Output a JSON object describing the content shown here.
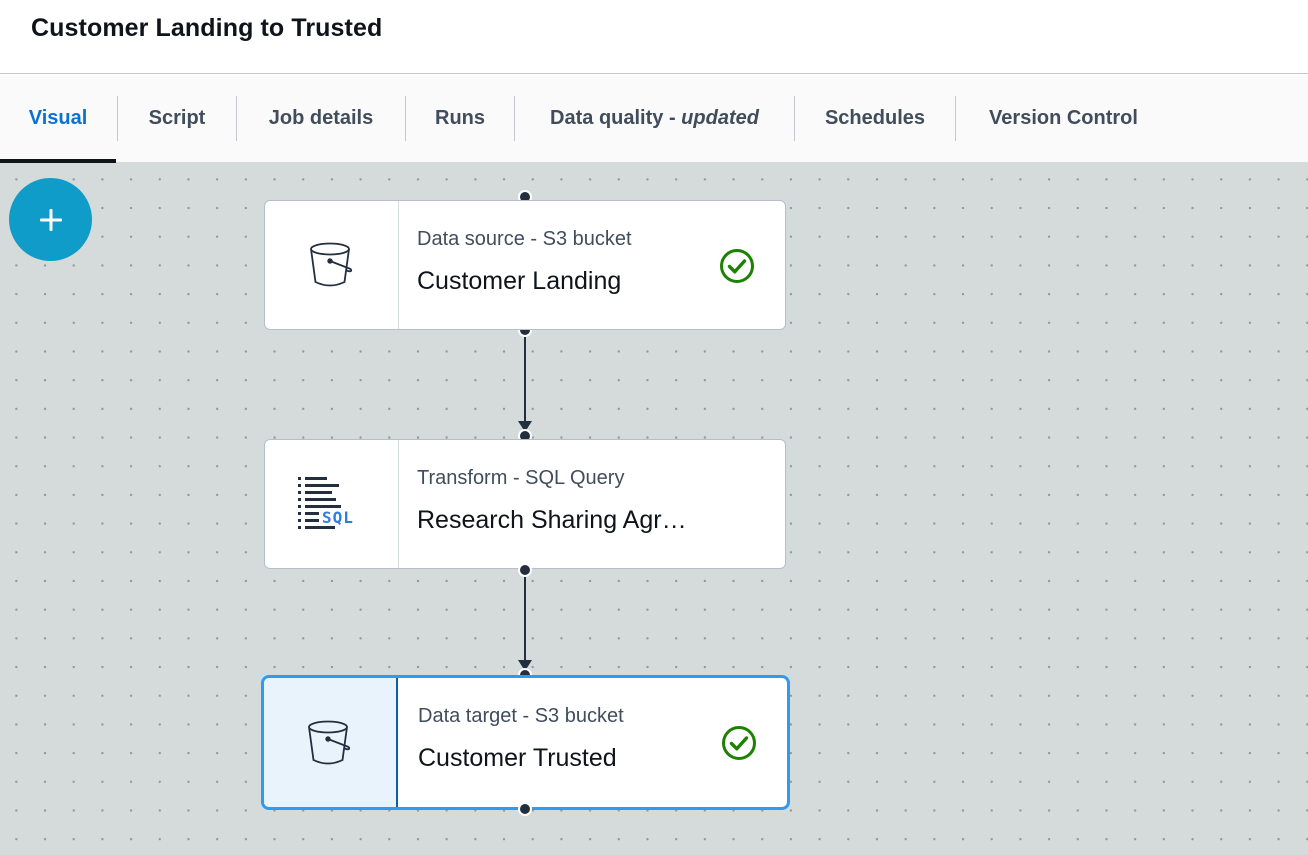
{
  "header": {
    "title": "Customer Landing to Trusted"
  },
  "tabs": [
    {
      "label": "Visual",
      "active": true
    },
    {
      "label": "Script"
    },
    {
      "label": "Job details"
    },
    {
      "label": "Runs"
    },
    {
      "label": "Data quality - ",
      "suffix": "updated"
    },
    {
      "label": "Schedules"
    },
    {
      "label": "Version Control"
    }
  ],
  "canvas": {
    "add_button": {
      "icon": "plus-icon",
      "color": "#0f9cc8"
    },
    "nodes": [
      {
        "type": "Data source - S3 bucket",
        "name": "Customer Landing",
        "icon": "s3-bucket-icon",
        "status": "success-check-icon"
      },
      {
        "type": "Transform - SQL Query",
        "name": "Research Sharing Agr…",
        "icon": "sql-query-icon"
      },
      {
        "type": "Data target - S3 bucket",
        "name": "Customer Trusted",
        "icon": "s3-bucket-icon",
        "status": "success-check-icon",
        "selected": true
      }
    ]
  },
  "colors": {
    "active_tab": "#0972d3",
    "success": "#1d8102",
    "selection": "#2f9bf0"
  }
}
